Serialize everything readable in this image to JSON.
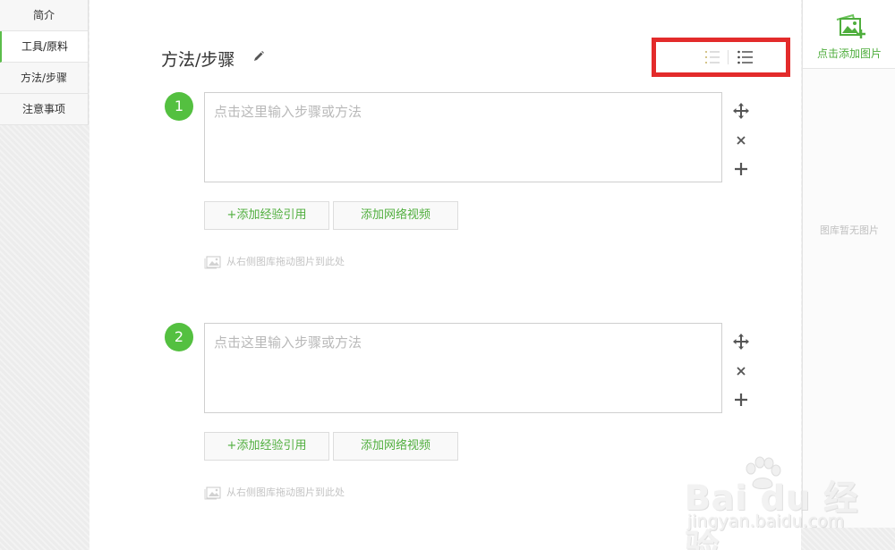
{
  "nav": {
    "items": [
      {
        "label": "简介"
      },
      {
        "label": "工具/原料"
      },
      {
        "label": "方法/步骤"
      },
      {
        "label": "注意事项"
      }
    ]
  },
  "section": {
    "title": "方法/步骤"
  },
  "steps": [
    {
      "number": "1",
      "placeholder": "点击这里输入步骤或方法",
      "add_reference_label": "+添加经验引用",
      "add_video_label": "添加网络视频",
      "drag_hint": "从右侧图库拖动图片到此处"
    },
    {
      "number": "2",
      "placeholder": "点击这里输入步骤或方法",
      "add_reference_label": "+添加经验引用",
      "add_video_label": "添加网络视频",
      "drag_hint": "从右侧图库拖动图片到此处"
    }
  ],
  "gallery": {
    "add_label": "点击添加图片",
    "empty_text": "图库暂无图片"
  },
  "watermark": {
    "brand": "Bai du 经验",
    "url": "jingyan.baidu.com"
  },
  "colors": {
    "accent": "#54c040",
    "highlight": "#e32b2b"
  }
}
